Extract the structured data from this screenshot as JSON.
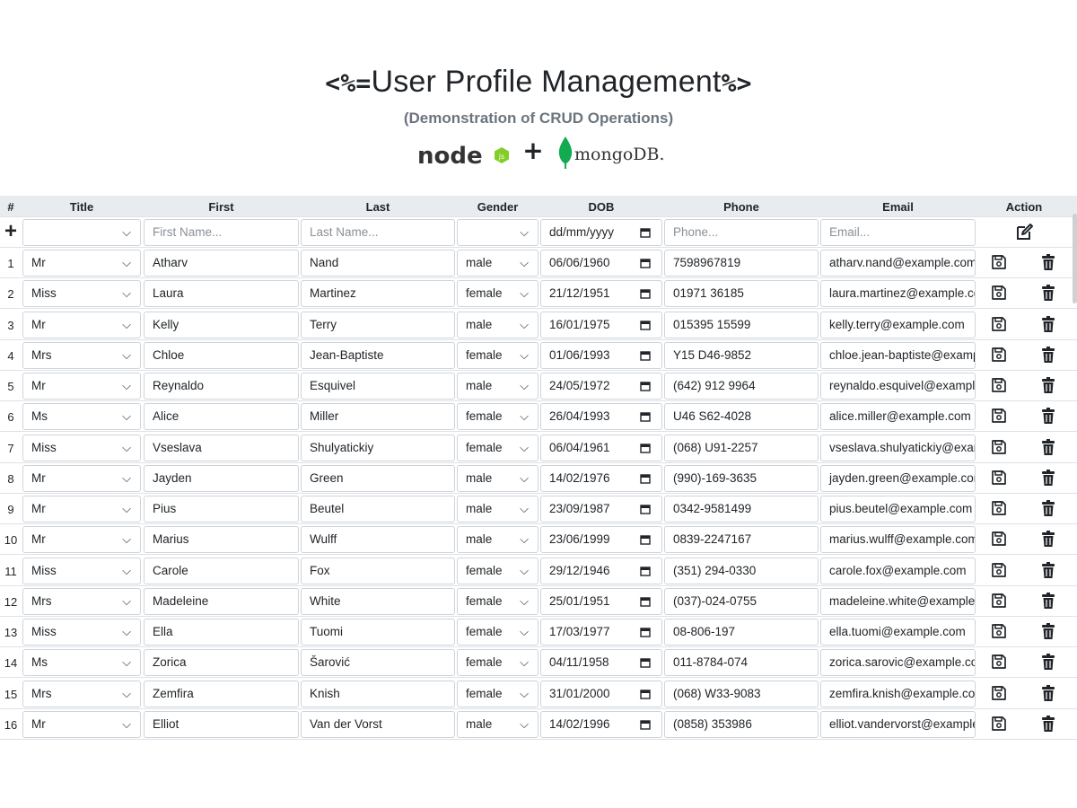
{
  "header": {
    "title_prefix": "<%=",
    "title": "User Profile Management",
    "title_suffix": "%>",
    "subtitle": "(Demonstration of CRUD Operations)",
    "logo_node_text": "node",
    "logo_js_text": "js",
    "logo_plus": "+",
    "logo_mongo_text": "mongoDB."
  },
  "table": {
    "columns": [
      "#",
      "Title",
      "First",
      "Last",
      "Gender",
      "DOB",
      "Phone",
      "Email",
      "Action"
    ],
    "new_row": {
      "add_symbol": "+",
      "title": "",
      "first_placeholder": "First Name...",
      "last_placeholder": "Last Name...",
      "gender": "",
      "dob_placeholder": "dd/mm/yyyy",
      "phone_placeholder": "Phone...",
      "email_placeholder": "Email..."
    },
    "rows": [
      {
        "n": "1",
        "title": "Mr",
        "first": "Atharv",
        "last": "Nand",
        "gender": "male",
        "dob": "06/06/1960",
        "phone": "7598967819",
        "email": "atharv.nand@example.com"
      },
      {
        "n": "2",
        "title": "Miss",
        "first": "Laura",
        "last": "Martinez",
        "gender": "female",
        "dob": "21/12/1951",
        "phone": "01971 36185",
        "email": "laura.martinez@example.com"
      },
      {
        "n": "3",
        "title": "Mr",
        "first": "Kelly",
        "last": "Terry",
        "gender": "male",
        "dob": "16/01/1975",
        "phone": "015395 15599",
        "email": "kelly.terry@example.com"
      },
      {
        "n": "4",
        "title": "Mrs",
        "first": "Chloe",
        "last": "Jean-Baptiste",
        "gender": "female",
        "dob": "01/06/1993",
        "phone": "Y15 D46-9852",
        "email": "chloe.jean-baptiste@example.com"
      },
      {
        "n": "5",
        "title": "Mr",
        "first": "Reynaldo",
        "last": "Esquivel",
        "gender": "male",
        "dob": "24/05/1972",
        "phone": "(642) 912 9964",
        "email": "reynaldo.esquivel@example.com"
      },
      {
        "n": "6",
        "title": "Ms",
        "first": "Alice",
        "last": "Miller",
        "gender": "female",
        "dob": "26/04/1993",
        "phone": "U46 S62-4028",
        "email": "alice.miller@example.com"
      },
      {
        "n": "7",
        "title": "Miss",
        "first": "Vseslava",
        "last": "Shulyatickiy",
        "gender": "female",
        "dob": "06/04/1961",
        "phone": "(068) U91-2257",
        "email": "vseslava.shulyatickiy@example.com"
      },
      {
        "n": "8",
        "title": "Mr",
        "first": "Jayden",
        "last": "Green",
        "gender": "male",
        "dob": "14/02/1976",
        "phone": "(990)-169-3635",
        "email": "jayden.green@example.com"
      },
      {
        "n": "9",
        "title": "Mr",
        "first": "Pius",
        "last": "Beutel",
        "gender": "male",
        "dob": "23/09/1987",
        "phone": "0342-9581499",
        "email": "pius.beutel@example.com"
      },
      {
        "n": "10",
        "title": "Mr",
        "first": "Marius",
        "last": "Wulff",
        "gender": "male",
        "dob": "23/06/1999",
        "phone": "0839-2247167",
        "email": "marius.wulff@example.com"
      },
      {
        "n": "11",
        "title": "Miss",
        "first": "Carole",
        "last": "Fox",
        "gender": "female",
        "dob": "29/12/1946",
        "phone": "(351) 294-0330",
        "email": "carole.fox@example.com"
      },
      {
        "n": "12",
        "title": "Mrs",
        "first": "Madeleine",
        "last": "White",
        "gender": "female",
        "dob": "25/01/1951",
        "phone": "(037)-024-0755",
        "email": "madeleine.white@example.com"
      },
      {
        "n": "13",
        "title": "Miss",
        "first": "Ella",
        "last": "Tuomi",
        "gender": "female",
        "dob": "17/03/1977",
        "phone": "08-806-197",
        "email": "ella.tuomi@example.com"
      },
      {
        "n": "14",
        "title": "Ms",
        "first": "Zorica",
        "last": "Šarović",
        "gender": "female",
        "dob": "04/11/1958",
        "phone": "011-8784-074",
        "email": "zorica.sarovic@example.com"
      },
      {
        "n": "15",
        "title": "Mrs",
        "first": "Zemfira",
        "last": "Knish",
        "gender": "female",
        "dob": "31/01/2000",
        "phone": "(068) W33-9083",
        "email": "zemfira.knish@example.com"
      },
      {
        "n": "16",
        "title": "Mr",
        "first": "Elliot",
        "last": "Van der Vorst",
        "gender": "male",
        "dob": "14/02/1996",
        "phone": "(0858) 353986",
        "email": "elliot.vandervorst@example.com"
      }
    ]
  },
  "icons": {
    "add": "plus-icon",
    "create": "edit-icon",
    "save": "save-icon",
    "delete": "trash-icon",
    "select": "chevron-down-icon",
    "date": "calendar-icon"
  },
  "colors": {
    "node_green": "#83cd29",
    "node_dark": "#333333",
    "mongo_green": "#13aa52",
    "header_bg": "#e9ecef",
    "subtitle": "#6c757d"
  }
}
